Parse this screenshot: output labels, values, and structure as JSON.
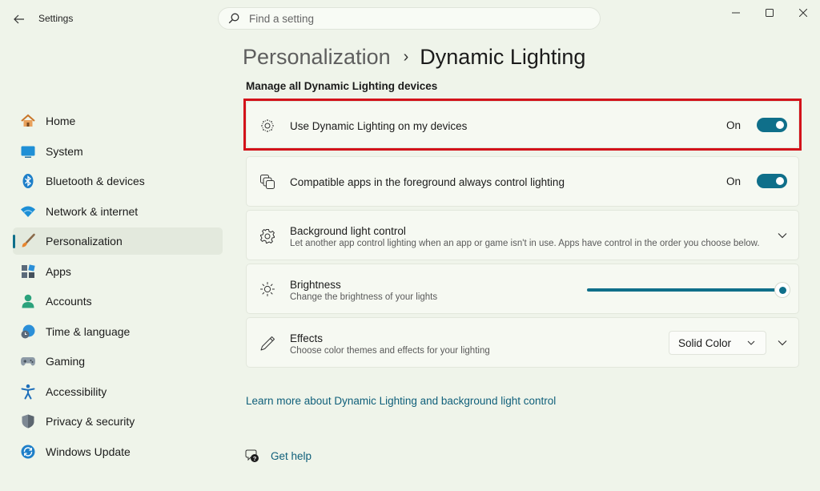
{
  "window": {
    "app_title": "Settings",
    "back_icon": "arrow-left-icon",
    "controls": [
      "minimize-icon",
      "maximize-icon",
      "close-icon"
    ]
  },
  "search": {
    "placeholder": "Find a setting",
    "icon": "search-icon"
  },
  "sidebar": {
    "items": [
      {
        "label": "Home",
        "icon": "home-icon"
      },
      {
        "label": "System",
        "icon": "monitor-icon"
      },
      {
        "label": "Bluetooth & devices",
        "icon": "bluetooth-icon"
      },
      {
        "label": "Network & internet",
        "icon": "wifi-icon"
      },
      {
        "label": "Personalization",
        "icon": "paintbrush-icon",
        "active": true
      },
      {
        "label": "Apps",
        "icon": "apps-icon"
      },
      {
        "label": "Accounts",
        "icon": "person-icon"
      },
      {
        "label": "Time & language",
        "icon": "clock-globe-icon"
      },
      {
        "label": "Gaming",
        "icon": "gamepad-icon"
      },
      {
        "label": "Accessibility",
        "icon": "accessibility-icon"
      },
      {
        "label": "Privacy & security",
        "icon": "shield-icon"
      },
      {
        "label": "Windows Update",
        "icon": "update-icon"
      }
    ]
  },
  "breadcrumb": {
    "parent": "Personalization",
    "separator": "›",
    "current": "Dynamic Lighting"
  },
  "section_title": "Manage all Dynamic Lighting devices",
  "settings": {
    "use_dynamic_lighting": {
      "title": "Use Dynamic Lighting on my devices",
      "state": "On",
      "on": true,
      "icon": "sun-dots-icon"
    },
    "compatible_apps": {
      "title": "Compatible apps in the foreground always control lighting",
      "state": "On",
      "on": true,
      "icon": "layered-apps-icon"
    },
    "background_light_control": {
      "title": "Background light control",
      "description": "Let another app control lighting when an app or game isn't in use. Apps have control in the order you choose below.",
      "icon": "gear-icon"
    },
    "brightness": {
      "title": "Brightness",
      "description": "Change the brightness of your lights",
      "value_percent": 100,
      "icon": "sun-icon"
    },
    "effects": {
      "title": "Effects",
      "description": "Choose color themes and effects for your lighting",
      "selected": "Solid Color",
      "icon": "pen-icon"
    }
  },
  "links": {
    "learn_more": "Learn more about Dynamic Lighting and background light control",
    "get_help": "Get help"
  },
  "colors": {
    "accent": "#0f6f8a",
    "highlight_box": "#d3121a",
    "background": "#eff4ea"
  }
}
